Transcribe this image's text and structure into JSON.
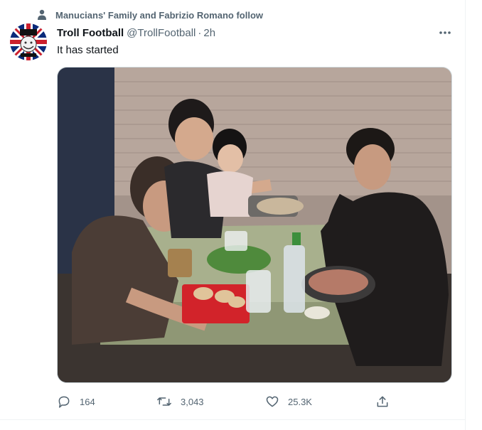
{
  "social_context": {
    "text": "Manucians' Family and Fabrizio Romano follow"
  },
  "tweet": {
    "display_name": "Troll Football",
    "handle": "@TrollFootball",
    "separator": "·",
    "time": "2h",
    "text": "It has started"
  },
  "icons": {
    "person": "person-icon",
    "more": "more-dots-icon",
    "reply": "reply-icon",
    "retweet": "retweet-icon",
    "like": "heart-icon",
    "share": "share-icon"
  },
  "actions": {
    "reply_count": "164",
    "retweet_count": "3,043",
    "like_count": "25.3K"
  },
  "media": {
    "description": "photo of four people eating at a low green plastic table"
  },
  "colors": {
    "text_primary": "#0f1419",
    "text_secondary": "#536471",
    "border": "#eff3f4"
  }
}
